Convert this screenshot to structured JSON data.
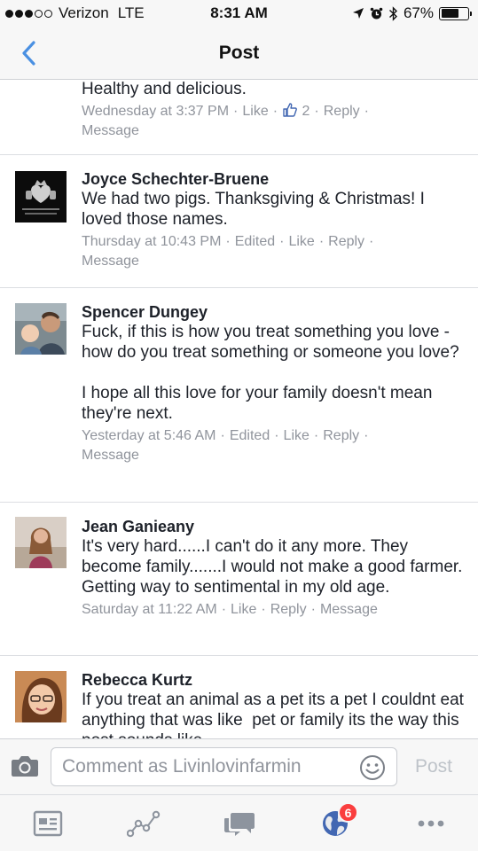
{
  "status_bar": {
    "carrier": "Verizon",
    "network": "LTE",
    "time": "8:31 AM",
    "battery": "67%",
    "battery_level": 0.67
  },
  "nav": {
    "title": "Post",
    "back_icon": "chevron-left-icon"
  },
  "comments": [
    {
      "name": "",
      "text": "Healthy and delicious.",
      "time": "Wednesday at 3:37 PM",
      "edited": "",
      "like": "Like",
      "like_count": "2",
      "reply": "Reply",
      "message": "Message"
    },
    {
      "name": "Joyce Schechter-Bruene",
      "text": "We had two pigs. Thanksgiving & Christmas! I loved those names.",
      "time": "Thursday at 10:43 PM",
      "edited": "Edited",
      "like": "Like",
      "reply": "Reply",
      "message": "Message"
    },
    {
      "name": "Spencer Dungey",
      "text": "Fuck, if this is how you treat something you love - how do you treat something or someone you love?\n\nI hope all this love for your family doesn't mean they're next.",
      "time": "Yesterday at 5:46 AM",
      "edited": "Edited",
      "like": "Like",
      "reply": "Reply",
      "message": "Message"
    },
    {
      "name": "Jean Ganieany",
      "text": "It's very hard......I can't do it any more. They become family.......I would not make a good farmer.  Getting way to sentimental in my old age.",
      "time": "Saturday at 11:22 AM",
      "like": "Like",
      "reply": "Reply",
      "message": "Message"
    },
    {
      "name": "Rebecca Kurtz",
      "text": "If you treat an animal as a pet its a pet I couldnt eat anything that was like  pet or family its the way this post sounds like"
    }
  ],
  "composer": {
    "placeholder": "Comment as Livinlovinfarmin",
    "post_label": "Post"
  },
  "tab_bar": {
    "notifications_badge": "6"
  },
  "colors": {
    "link_blue": "#4267b2",
    "meta_gray": "#90949c",
    "badge_red": "#fa3e3e"
  }
}
